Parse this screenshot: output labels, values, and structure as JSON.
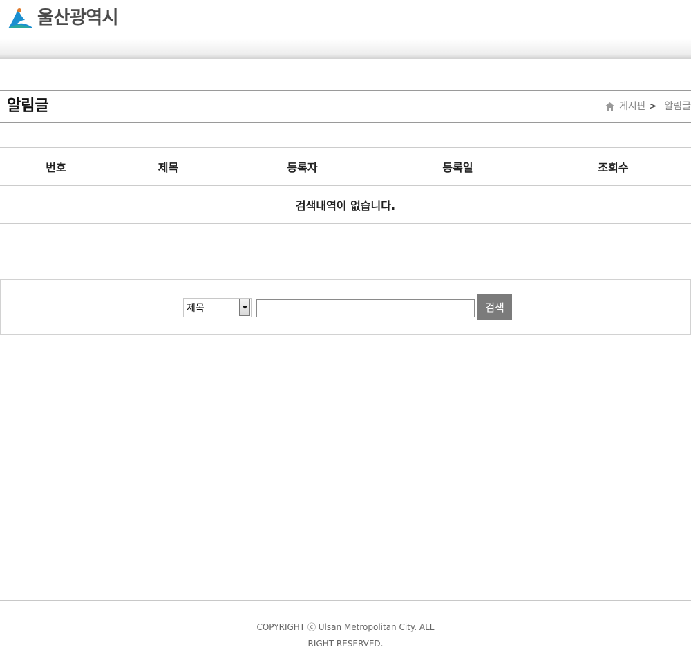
{
  "header": {
    "logo_text": "울산광역시",
    "logo_colors": {
      "primary": "#1a8fd0",
      "secondary": "#2aa8a0"
    }
  },
  "title_bar": {
    "page_title": "알림글",
    "breadcrumb": {
      "home_icon": "home-icon",
      "section": "게시판",
      "separator": ">",
      "current": "알림글"
    }
  },
  "table": {
    "columns": [
      "번호",
      "제목",
      "등록자",
      "등록일",
      "조회수"
    ],
    "empty_message": "검색내역이 없습니다."
  },
  "search": {
    "selected_field": "제목",
    "query_value": "",
    "button_label": "검색",
    "button_color": "#7b7b7b"
  },
  "footer": {
    "copyright": "COPYRIGHT ⓒ Ulsan Metropolitan City. ALL RIGHT RESERVED."
  }
}
